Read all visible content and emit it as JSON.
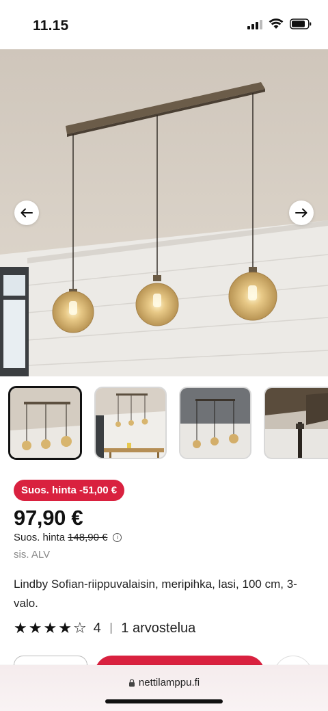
{
  "status_bar": {
    "time": "11.15"
  },
  "hero": {
    "image_alt_icon": "pendant-lamp-photo"
  },
  "thumbnails": [
    {
      "icon": "pendant-lamp-photo",
      "selected": true
    },
    {
      "icon": "dining-room-photo",
      "selected": false
    },
    {
      "icon": "lamp-dark-wall-photo",
      "selected": false
    },
    {
      "icon": "lamp-detail-photo",
      "selected": false
    }
  ],
  "product": {
    "discount_badge": "Suos. hinta -51,00 €",
    "price": "97,90 €",
    "ref_price_label": "Suos. hinta",
    "ref_price_old": "148,90 €",
    "vat_note": "sis. ALV",
    "title": "Lindby Sofian-riippuvalaisin, meripihka, lasi, 100 cm, 3-valo."
  },
  "rating": {
    "value": "4",
    "stars_filled": 4,
    "stars_total": 5,
    "review_count": "1 arvostelua"
  },
  "browser": {
    "url": "nettilamppu.fi"
  },
  "colors": {
    "accent": "#d9213f",
    "text": "#111111",
    "muted": "#888888"
  }
}
